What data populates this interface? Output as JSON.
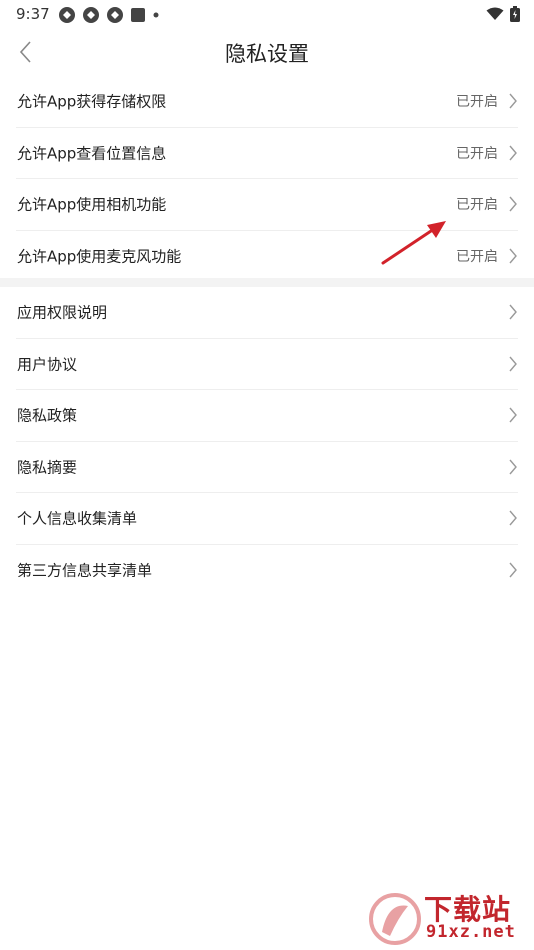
{
  "status_bar": {
    "time": "9:37",
    "icons": [
      "app-notification-icon",
      "app-notification-icon",
      "app-notification-icon",
      "square-notification-icon",
      "dot-icon"
    ],
    "right_icons": [
      "wifi-icon",
      "battery-icon"
    ]
  },
  "header": {
    "title": "隐私设置",
    "back_icon": "chevron-left-icon"
  },
  "permissions": [
    {
      "label": "允许App获得存储权限",
      "status": "已开启"
    },
    {
      "label": "允许App查看位置信息",
      "status": "已开启"
    },
    {
      "label": "允许App使用相机功能",
      "status": "已开启"
    },
    {
      "label": "允许App使用麦克风功能",
      "status": "已开启"
    }
  ],
  "links": [
    {
      "label": "应用权限说明"
    },
    {
      "label": "用户协议"
    },
    {
      "label": "隐私政策"
    },
    {
      "label": "隐私摘要"
    },
    {
      "label": "个人信息收集清单"
    },
    {
      "label": "第三方信息共享清单"
    }
  ],
  "annotation": {
    "icon": "red-arrow-icon",
    "color": "#d2222a"
  },
  "watermark": {
    "line1": "下载站",
    "line2": "91xz.net",
    "color": "#c2262d"
  },
  "colors": {
    "divider": "#eeeeee",
    "band": "#f3f3f3",
    "status_text": "#666666"
  }
}
